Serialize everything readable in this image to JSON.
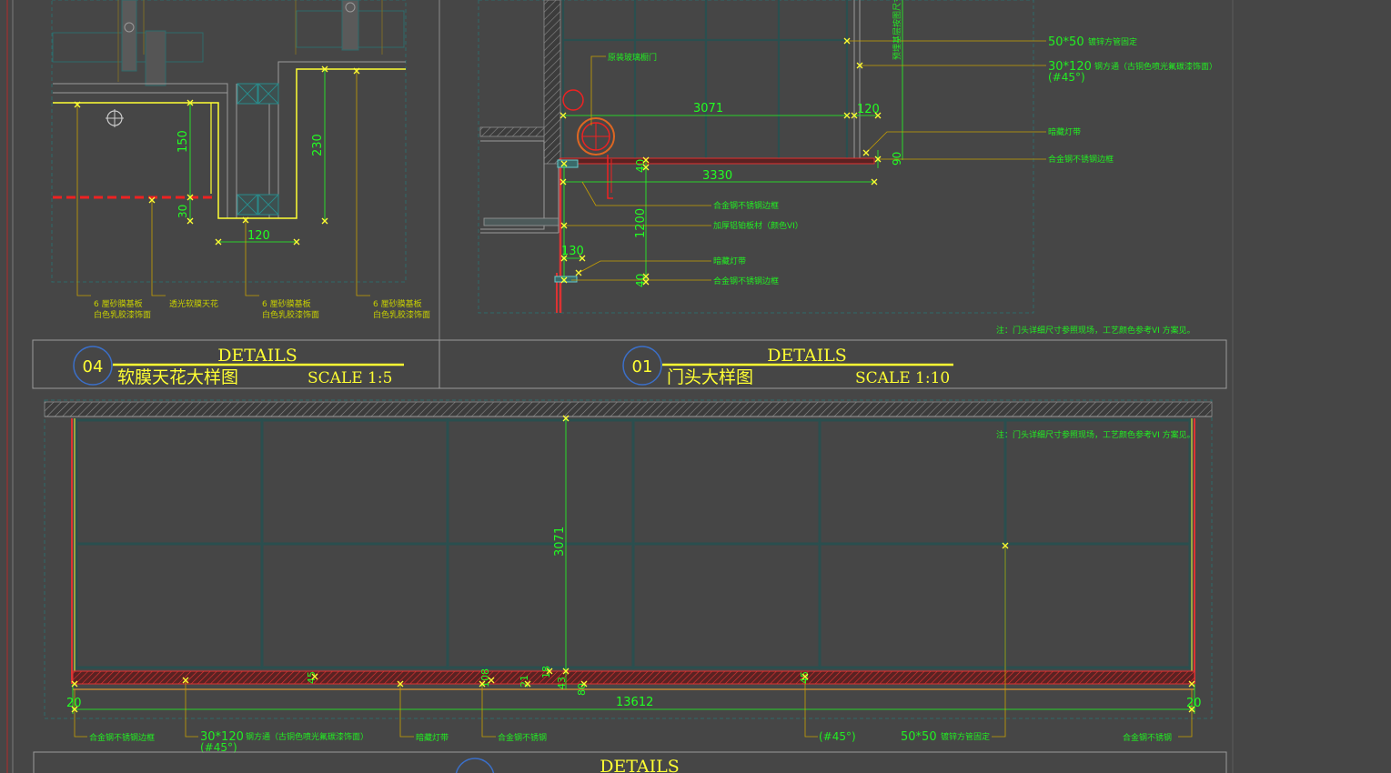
{
  "colors": {
    "background": "#464646",
    "dimension_green": "#22ff22",
    "annotation_yellow": "#ffff33",
    "frame_gray": "#9a9a9a",
    "grid_teal": "#2a4f4f",
    "hatch_red": "#cc2222",
    "badge_blue": "#3b6fc8"
  },
  "panels": {
    "detail_04": {
      "number": "04",
      "heading": "DETAILS",
      "subtitle": "软膜天花大样图",
      "scale": "SCALE 1:5",
      "dims": {
        "d150": "150",
        "d230": "230",
        "d30": "30",
        "d120": "120"
      },
      "callouts": {
        "c1_line1": "6 厘砂膜基板",
        "c1_line2": "白色乳胶漆饰面",
        "c2": "透光软膜天花",
        "c3_line1": "6 厘砂膜基板",
        "c3_line2": "白色乳胶漆饰面",
        "c4_line1": "6 厘砂膜基板",
        "c4_line2": "白色乳胶漆饰面"
      }
    },
    "detail_01": {
      "number": "01",
      "heading": "DETAILS",
      "subtitle": "门头大样图",
      "scale": "SCALE 1:10",
      "dims": {
        "d3071": "3071",
        "d120": "120",
        "d40a": "40",
        "d3330": "3330",
        "d1200": "1200",
        "d130": "130",
        "d40b": "40",
        "d90": "90"
      },
      "callouts": {
        "door": "原装玻璃橱门",
        "steel_50": "50*50",
        "steel_50_text": "镀锌方管固定",
        "steel_30": "30*120",
        "steel_30_text": "钢方通（古铜色喷光氟碳漆饰面）",
        "angle": "(#45°)",
        "vertical_note": "预埋基层按图尺寸",
        "light_strip": "暗藏灯带",
        "edge_trim": "合金钢不锈钢边框",
        "a1": "合金钢不锈钢边框",
        "a2": "加厚铝铂板材（颜色VI）",
        "a3": "暗藏灯带",
        "a4": "合金钢不锈钢边框",
        "note": "注：门头详细尺寸参照现场，工艺颜色参考VI 方案见。"
      }
    },
    "detail_03": {
      "heading": "DETAILS",
      "note": "注：门头详细尺寸参照现场，工艺颜色参考VI 方案见。",
      "dims": {
        "height": "3071",
        "total": "13612",
        "left": "20",
        "right": "20",
        "a45_1": "45",
        "a108": "108",
        "a21": "21",
        "a18": "18",
        "a43": "43",
        "a80": "80",
        "a45_2": "45"
      },
      "callouts": {
        "b1": "合金钢不锈钢边框",
        "b2_main": "30*120",
        "b2_text": "钢方通（古铜色喷光氟碳漆饰面）",
        "b2_angle": "(#45°)",
        "b3": "暗藏灯带",
        "b4": "合金钢不锈钢",
        "b5_angle": "(#45°)",
        "b6_main": "50*50",
        "b6_text": "镀锌方管固定",
        "b7": "合金钢不锈钢"
      }
    }
  }
}
